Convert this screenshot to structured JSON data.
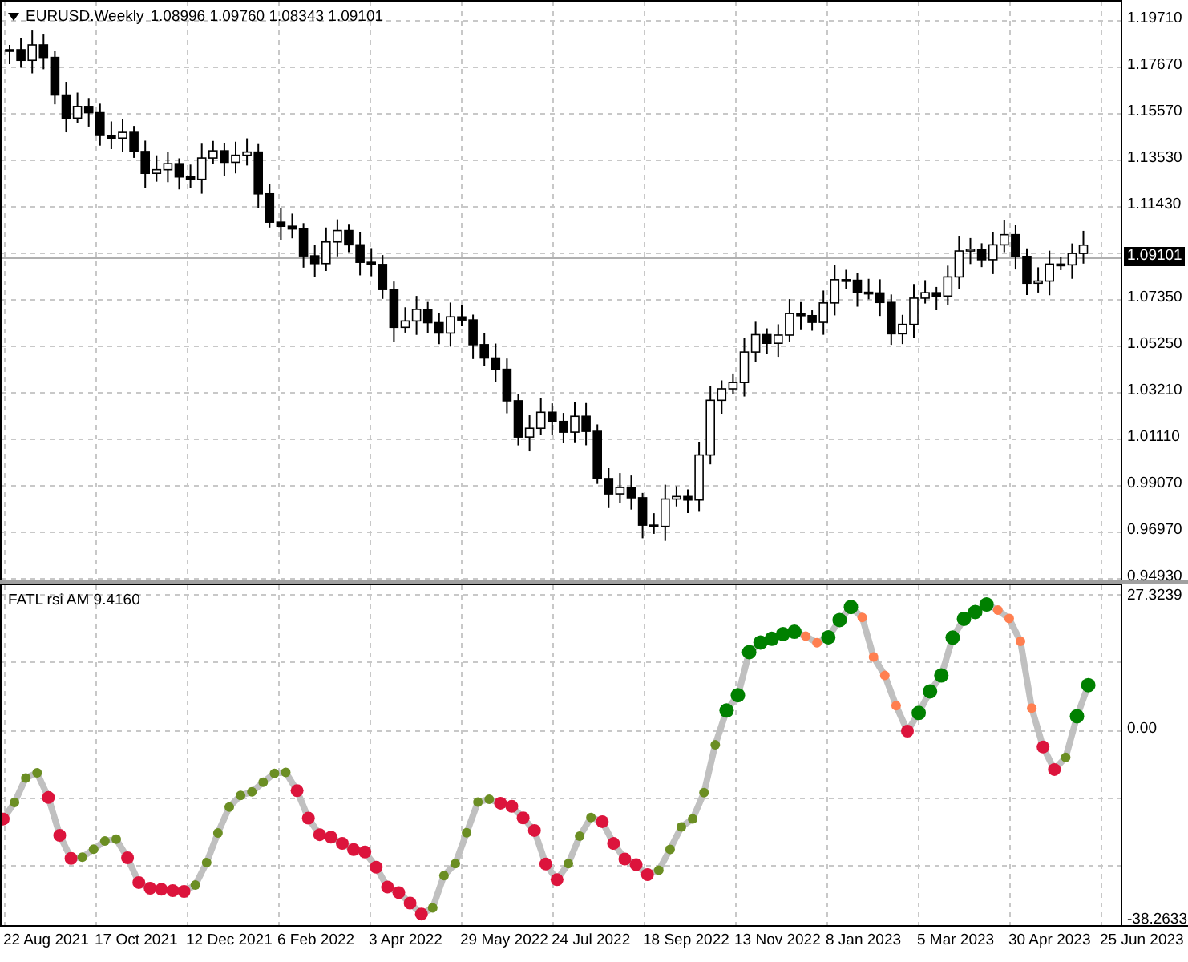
{
  "header": {
    "symbol": "EURUSD.Weekly",
    "ohlc": "1.08996 1.09760 1.08343 1.09101"
  },
  "price_axis": [
    "1.19710",
    "1.17670",
    "1.15570",
    "1.13530",
    "1.11430",
    "1.07350",
    "1.05250",
    "1.03210",
    "1.01110",
    "0.99070",
    "0.96970",
    "0.94930"
  ],
  "current_price": "1.09101",
  "indicator": {
    "title": "FATL rsi AM 9.4160",
    "axis": [
      "27.3239",
      "0.00",
      "-38.2633"
    ]
  },
  "time_axis": [
    "22 Aug 2021",
    "17 Oct 2021",
    "12 Dec 2021",
    "6 Feb 2022",
    "3 Apr 2022",
    "29 May 2022",
    "24 Jul 2022",
    "18 Sep 2022",
    "13 Nov 2022",
    "8 Jan 2023",
    "5 Mar 2023",
    "30 Apr 2023",
    "25 Jun 2023"
  ]
}
